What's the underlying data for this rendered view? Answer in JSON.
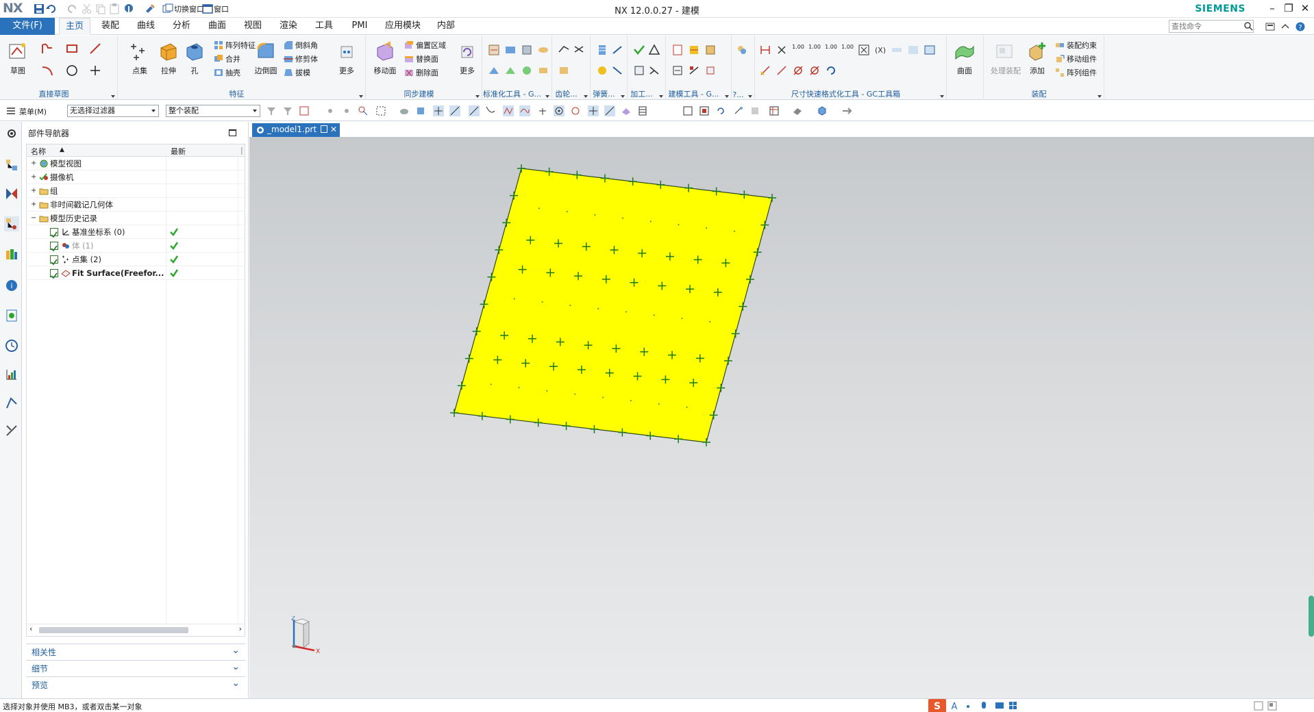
{
  "window": {
    "title": "NX 12.0.0.27 - 建模",
    "brand": "SIEMENS",
    "app_logo": "NX",
    "quick_access": [
      "save-icon",
      "undo-icon",
      "redo-icon",
      "cut-icon",
      "copy-icon",
      "paste-icon",
      "touch-mode-icon",
      "repeat-command-icon"
    ],
    "switch_window_label": "切换窗口",
    "window_label": "窗口",
    "controls": [
      "minimize-icon",
      "restore-icon",
      "close-icon"
    ]
  },
  "menubar": {
    "file": "文件(F)",
    "tabs": [
      "主页",
      "装配",
      "曲线",
      "分析",
      "曲面",
      "视图",
      "渲染",
      "工具",
      "PMI",
      "应用模块",
      "内部"
    ],
    "active_tab": "主页",
    "search_placeholder": "查找命令"
  },
  "ribbon": {
    "groups": {
      "sketch": {
        "label": "直接草图",
        "button": "草图"
      },
      "feature": {
        "label": "特征",
        "big": [
          "点集",
          "拉伸",
          "孔",
          "边倒圆",
          "更多"
        ],
        "small": [
          "阵列特征",
          "合并",
          "抽壳",
          "倒斜角",
          "修剪体",
          "拔模"
        ]
      },
      "sync": {
        "label": "同步建模",
        "big": [
          "移动面",
          "更多"
        ],
        "small": [
          "偏置区域",
          "替换面",
          "删除面"
        ]
      },
      "std_tools": {
        "label": "标准化工具 - G..."
      },
      "gear": {
        "label": "齿轮..."
      },
      "spring": {
        "label": "弹簧..."
      },
      "machining": {
        "label": "加工..."
      },
      "build_tools": {
        "label": "建模工具 - G..."
      },
      "misc": {
        "label": "?..."
      },
      "dim_quick": {
        "label": "尺寸快速格式化工具 - GC工具箱",
        "values": [
          "1.00",
          "1.00",
          "1.00",
          "1.00"
        ]
      },
      "surface": {
        "label": "曲面",
        "button": "曲面"
      },
      "assembly": {
        "label": "装配",
        "big": [
          "处理装配",
          "添加"
        ],
        "small": [
          "装配约束",
          "移动组件",
          "阵列组件"
        ]
      }
    }
  },
  "selbar": {
    "menu": "菜单(M)",
    "filter": "无选择过滤器",
    "scope": "整个装配"
  },
  "navigator": {
    "title": "部件导航器",
    "col_name": "名称",
    "col_latest": "最新",
    "rows": [
      {
        "label": "模型视图",
        "indent": 0,
        "has_check": false,
        "latest": false,
        "bold": false,
        "dim": false
      },
      {
        "label": "摄像机",
        "indent": 0,
        "has_check": false,
        "latest": false,
        "bold": false,
        "dim": false
      },
      {
        "label": "组",
        "indent": 0,
        "has_check": false,
        "latest": false,
        "bold": false,
        "dim": false
      },
      {
        "label": "非时间戳记几何体",
        "indent": 0,
        "has_check": false,
        "latest": false,
        "bold": false,
        "dim": false
      },
      {
        "label": "模型历史记录",
        "indent": 0,
        "has_check": false,
        "latest": false,
        "bold": false,
        "dim": false
      },
      {
        "label": "基准坐标系 (0)",
        "indent": 1,
        "has_check": true,
        "latest": true,
        "bold": false,
        "dim": false
      },
      {
        "label": "体 (1)",
        "indent": 1,
        "has_check": true,
        "latest": true,
        "bold": false,
        "dim": true
      },
      {
        "label": "点集 (2)",
        "indent": 1,
        "has_check": true,
        "latest": true,
        "bold": false,
        "dim": false
      },
      {
        "label": "Fit Surface(Freefor...",
        "indent": 1,
        "has_check": true,
        "latest": true,
        "bold": true,
        "dim": false
      }
    ],
    "panels": [
      "相关性",
      "细节",
      "预览"
    ]
  },
  "document": {
    "tab": "_model1.prt"
  },
  "viewport": {
    "surface_color": "#ffff00",
    "marker_color": "#1a7a1a",
    "background_top": "#c6c9cc",
    "background_bottom": "#eaebec",
    "triad": {
      "z": "Z",
      "x": "X"
    }
  },
  "status": {
    "message": "选择对象并使用 MB3，或者双击某一对象",
    "ime": "S",
    "ime_mode": "A"
  },
  "colors": {
    "accent": "#2b72bd",
    "ribbon_bg": "#f4f6f8",
    "group_label": "#1f5da0",
    "siemens": "#009999",
    "check_green": "#2da82d"
  }
}
